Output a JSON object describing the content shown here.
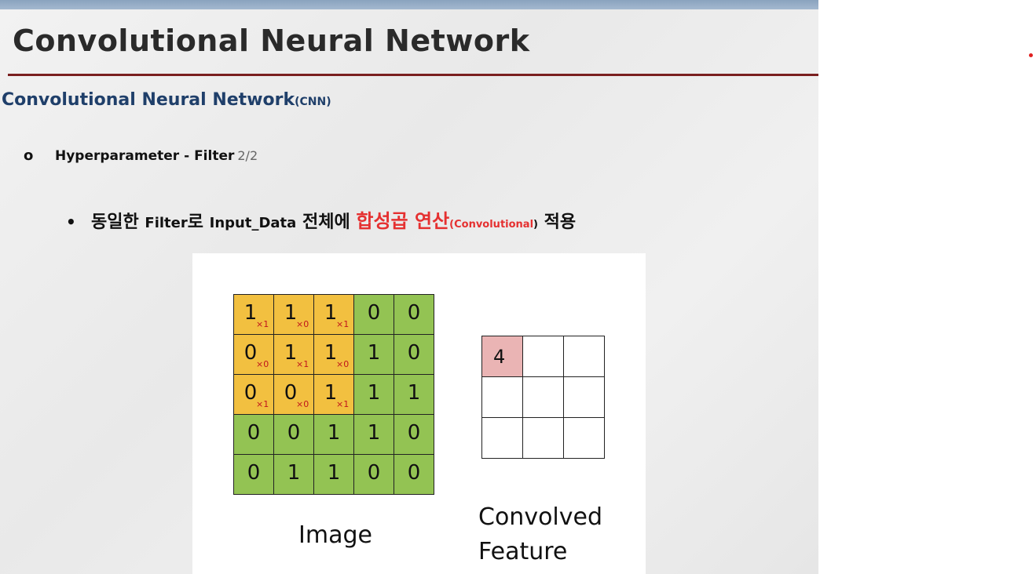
{
  "slide": {
    "title": "Convolutional Neural Network",
    "subtitle": "Convolutional Neural Network",
    "subtitle_abbr": "(CNN)",
    "bullet1": {
      "marker": "o",
      "text": "Hyperparameter - Filter",
      "page": "2/2"
    },
    "bullet2": {
      "marker": "•",
      "part1": "동일한",
      "part2": "Filter",
      "part3": "로",
      "part4": "Input_Data",
      "part5": "전체에",
      "highlight": "합성곱 연산",
      "highlight_sub": "(Convolutional",
      "paren_close": ")",
      "part6": "적용"
    }
  },
  "figure": {
    "image_label": "Image",
    "feature_label_line1": "Convolved",
    "feature_label_line2": "Feature",
    "image_matrix": [
      [
        {
          "v": "1",
          "w": "×1"
        },
        {
          "v": "1",
          "w": "×0"
        },
        {
          "v": "1",
          "w": "×1"
        },
        {
          "v": "0",
          "w": ""
        },
        {
          "v": "0",
          "w": ""
        }
      ],
      [
        {
          "v": "0",
          "w": "×0"
        },
        {
          "v": "1",
          "w": "×1"
        },
        {
          "v": "1",
          "w": "×0"
        },
        {
          "v": "1",
          "w": ""
        },
        {
          "v": "0",
          "w": ""
        }
      ],
      [
        {
          "v": "0",
          "w": "×1"
        },
        {
          "v": "0",
          "w": "×0"
        },
        {
          "v": "1",
          "w": "×1"
        },
        {
          "v": "1",
          "w": ""
        },
        {
          "v": "1",
          "w": ""
        }
      ],
      [
        {
          "v": "0",
          "w": ""
        },
        {
          "v": "0",
          "w": ""
        },
        {
          "v": "1",
          "w": ""
        },
        {
          "v": "1",
          "w": ""
        },
        {
          "v": "0",
          "w": ""
        }
      ],
      [
        {
          "v": "0",
          "w": ""
        },
        {
          "v": "1",
          "w": ""
        },
        {
          "v": "1",
          "w": ""
        },
        {
          "v": "0",
          "w": ""
        },
        {
          "v": "0",
          "w": ""
        }
      ]
    ],
    "feature_matrix": [
      [
        "4",
        "",
        ""
      ],
      [
        "",
        "",
        ""
      ],
      [
        "",
        "",
        ""
      ]
    ]
  },
  "colors": {
    "filter_cell": "#f2c040",
    "image_cell": "#93c353",
    "feature_filled": "#eab4b4",
    "weight_text": "#c0141c",
    "title_rule": "#7a1f1f",
    "subtitle": "#1f3f6a",
    "highlight": "#e53030"
  }
}
